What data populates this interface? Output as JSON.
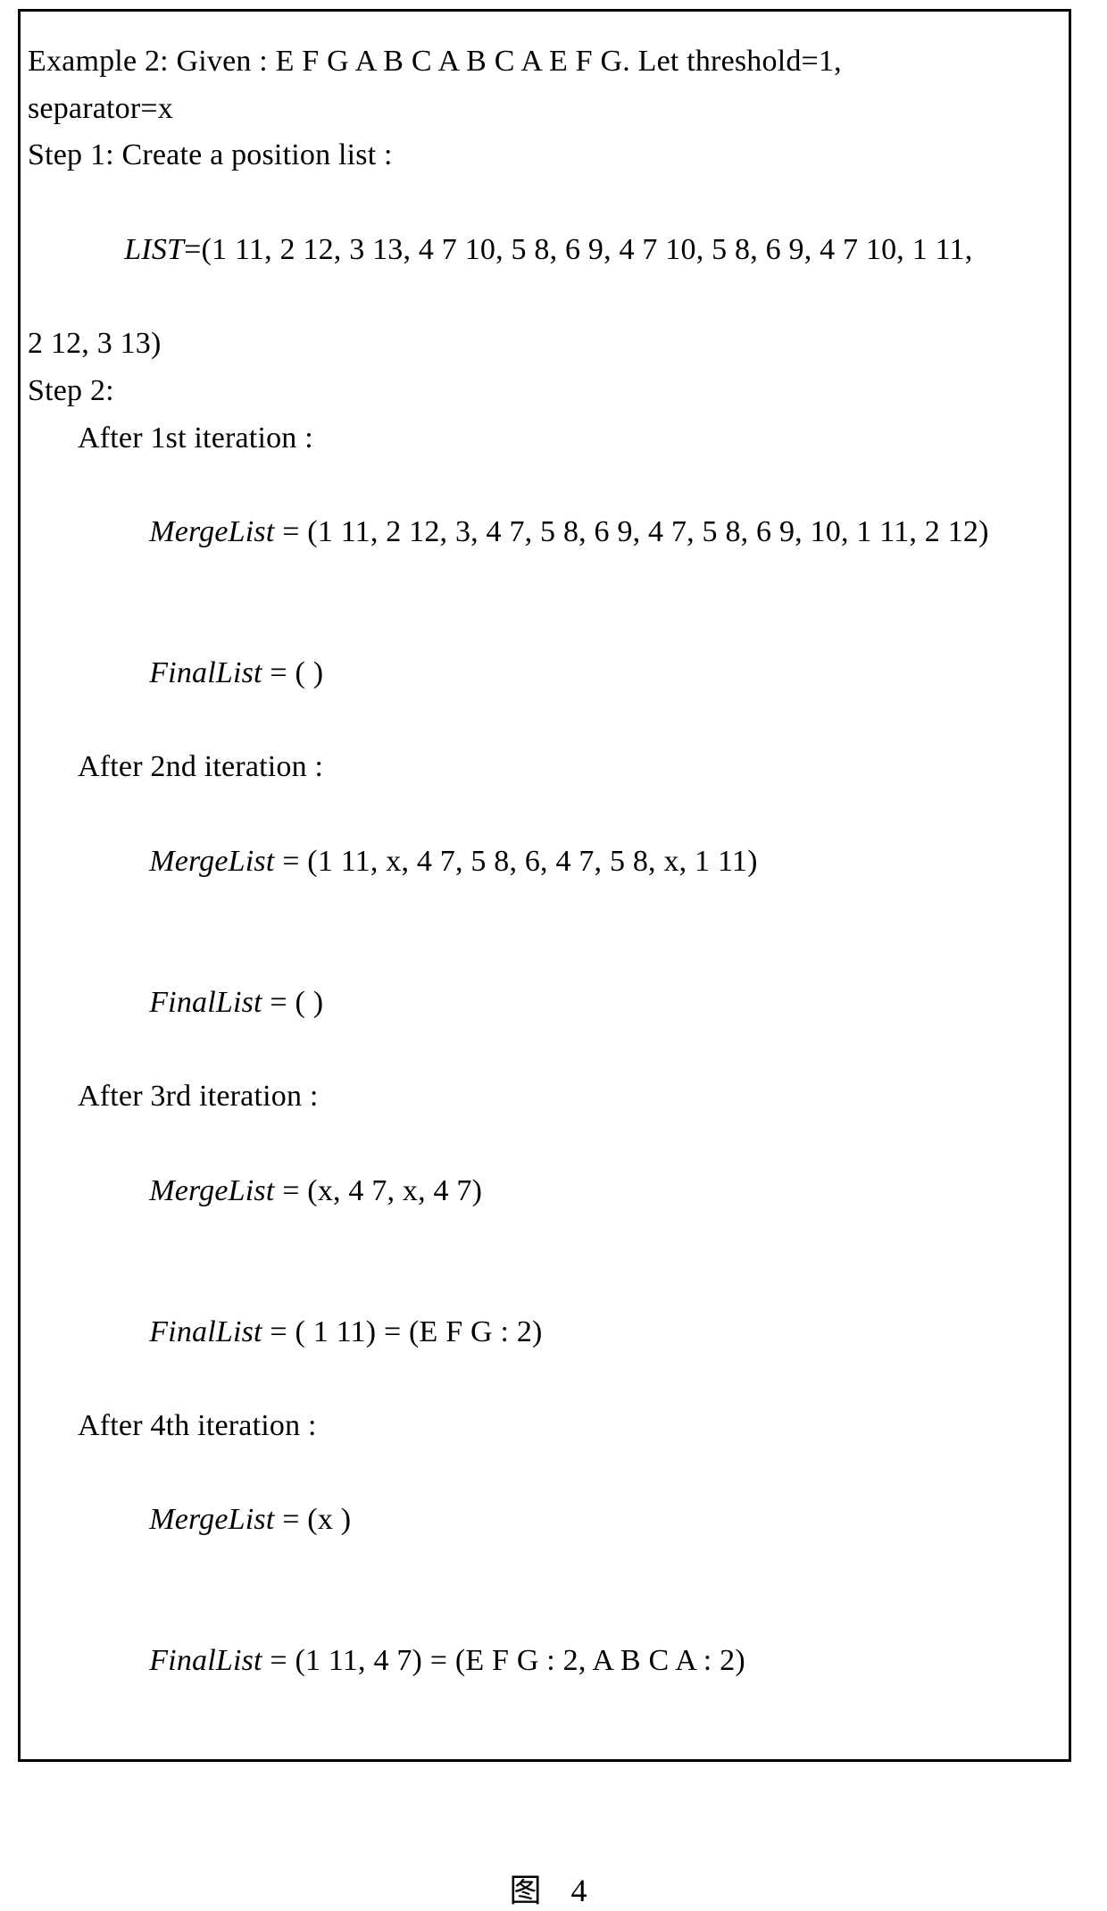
{
  "box": {
    "given_a": "Example 2: Given : E F G A B C A B C A E F G. Let threshold=1,",
    "given_b": "separator=x",
    "step1_h": "Step 1: Create a position list :",
    "list_label": "LIST",
    "list_rest_a": "=(1 11, 2 12, 3 13, 4 7 10, 5 8, 6 9, 4 7 10, 5 8, 6 9, 4 7 10, 1 11,",
    "list_rest_b": "2 12, 3 13)",
    "step2_h": "Step 2:",
    "it1_h": "After 1st iteration :",
    "it1_ml_label": "MergeList",
    "it1_ml_rest": " = (1 11, 2 12, 3, 4 7, 5 8, 6 9, 4 7, 5 8, 6 9, 10, 1 11, 2 12)",
    "it1_fl_label": "FinalList",
    "it1_fl_rest": " = ( )",
    "it2_h": "After 2nd iteration :",
    "it2_ml_label": "MergeList",
    "it2_ml_rest": " = (1 11, x, 4 7, 5 8, 6, 4 7, 5 8, x, 1 11)",
    "it2_fl_label": "FinalList",
    "it2_fl_rest": " = ( )",
    "it3_h": "After 3rd iteration :",
    "it3_ml_label": "MergeList",
    "it3_ml_rest": " = (x, 4 7, x, 4 7)",
    "it3_fl_label": "FinalList",
    "it3_fl_rest": " = ( 1 11) = (E F G : 2)",
    "it4_h": "After 4th iteration :",
    "it4_ml_label": "MergeList",
    "it4_ml_rest": " = (x )",
    "it4_fl_label": "FinalList",
    "it4_fl_rest": " = (1 11, 4 7) = (E F G : 2, A B C A : 2)"
  },
  "caption": "图 4"
}
